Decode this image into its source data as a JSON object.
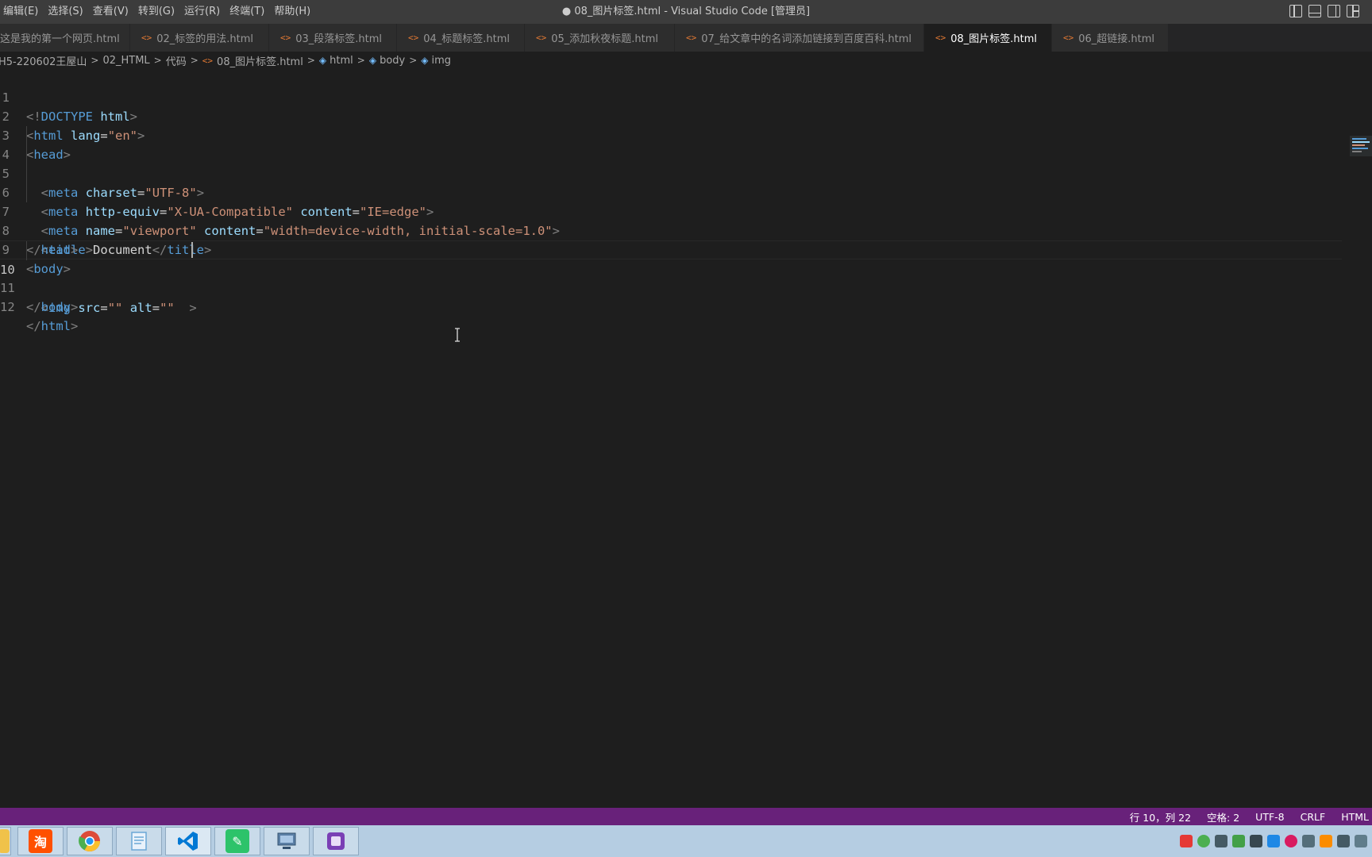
{
  "window": {
    "title": "● 08_图片标签.html - Visual Studio Code [管理员]"
  },
  "menu": [
    "编辑(E)",
    "选择(S)",
    "查看(V)",
    "转到(G)",
    "运行(R)",
    "终端(T)",
    "帮助(H)"
  ],
  "layout_icons": [
    "toggle-primary-sidebar-icon",
    "toggle-panel-icon",
    "toggle-secondary-sidebar-icon",
    "customize-layout-icon"
  ],
  "tabs": [
    {
      "label": "这是我的第一个网页.html",
      "active": false,
      "dirty": false
    },
    {
      "label": "02_标签的用法.html",
      "active": false,
      "dirty": false
    },
    {
      "label": "03_段落标签.html",
      "active": false,
      "dirty": false
    },
    {
      "label": "04_标题标签.html",
      "active": false,
      "dirty": false
    },
    {
      "label": "05_添加秋夜标题.html",
      "active": false,
      "dirty": false
    },
    {
      "label": "07_给文章中的名词添加链接到百度百科.html",
      "active": false,
      "dirty": false
    },
    {
      "label": "08_图片标签.html",
      "active": true,
      "dirty": true
    },
    {
      "label": "06_超链接.html",
      "active": false,
      "dirty": false
    }
  ],
  "breadcrumb": {
    "root": "H5-220602王屋山",
    "folder1": "02_HTML",
    "folder2": "代码",
    "file": "08_图片标签.html",
    "sym1": "html",
    "sym2": "body",
    "sym3": "img"
  },
  "editor": {
    "lines": [
      {
        "n": "1"
      },
      {
        "n": "2"
      },
      {
        "n": "3"
      },
      {
        "n": "4"
      },
      {
        "n": "5"
      },
      {
        "n": "6"
      },
      {
        "n": "7"
      },
      {
        "n": "8"
      },
      {
        "n": "9"
      },
      {
        "n": "10"
      },
      {
        "n": "11"
      },
      {
        "n": "12"
      }
    ],
    "current_line": 10,
    "tokens": {
      "l1": {
        "a": "<!",
        "b": "DOCTYPE",
        "c": "html",
        "d": ">"
      },
      "l2": {
        "a": "<",
        "b": "html",
        "c": "lang",
        "d": "=",
        "e": "\"en\"",
        "f": ">"
      },
      "l3": {
        "a": "<",
        "b": "head",
        "c": ">"
      },
      "l4": {
        "a": "<",
        "b": "meta",
        "c": "charset",
        "d": "=",
        "e": "\"UTF-8\"",
        "f": ">"
      },
      "l5": {
        "a": "<",
        "b": "meta",
        "c": "http-equiv",
        "d": "=",
        "e": "\"X-UA-Compatible\"",
        "f": "content",
        "g": "=",
        "h": "\"IE=edge\"",
        "i": ">"
      },
      "l6": {
        "a": "<",
        "b": "meta",
        "c": "name",
        "d": "=",
        "e": "\"viewport\"",
        "f": "content",
        "g": "=",
        "h": "\"width=device-width, initial-scale=1.0\"",
        "i": ">"
      },
      "l7": {
        "a": "<",
        "b": "title",
        "c": ">",
        "d": "Document",
        "e": "</",
        "f": "title",
        "g": ">"
      },
      "l8": {
        "a": "</",
        "b": "head",
        "c": ">"
      },
      "l9": {
        "a": "<",
        "b": "body",
        "c": ">"
      },
      "l10": {
        "a": "<",
        "b": "img",
        "c": "src",
        "d": "=",
        "e": "\"\"",
        "f": "alt",
        "g": "=",
        "h": "\"\"",
        "i": ">"
      },
      "l11": {
        "a": "</",
        "b": "body",
        "c": ">"
      },
      "l12": {
        "a": "</",
        "b": "html",
        "c": ">"
      }
    }
  },
  "statusbar": {
    "position": "行 10，列 22",
    "spaces": "空格: 2",
    "encoding": "UTF-8",
    "eol": "CRLF",
    "language": "HTML"
  },
  "taskbar": {
    "apps": [
      {
        "name": "file-explorer-icon",
        "color": "#f0c24a"
      },
      {
        "name": "taobao-icon",
        "color": "#ff5000",
        "glyph": "淘"
      },
      {
        "name": "chrome-icon",
        "color": "#dd4b39"
      },
      {
        "name": "notepad-icon",
        "color": "#6aa7d6"
      },
      {
        "name": "vscode-icon",
        "color": "#0078d4"
      },
      {
        "name": "wechat-like-icon",
        "color": "#2dc36a"
      },
      {
        "name": "computer-icon",
        "color": "#5b7fa6"
      },
      {
        "name": "media-icon",
        "color": "#7a3fb5"
      }
    ],
    "tray": [
      "sogou-icon",
      "chrome-tray-icon",
      "usb-icon",
      "network-icon",
      "printer-icon",
      "pen-icon",
      "settings-icon",
      "display-icon",
      "security-icon",
      "volume-icon",
      "clipboard-icon"
    ]
  },
  "colors": {
    "statusbar": "#68217a",
    "editor_bg": "#1e1e1e",
    "tag": "#569cd6",
    "attr": "#9cdcfe",
    "string": "#ce9178"
  }
}
